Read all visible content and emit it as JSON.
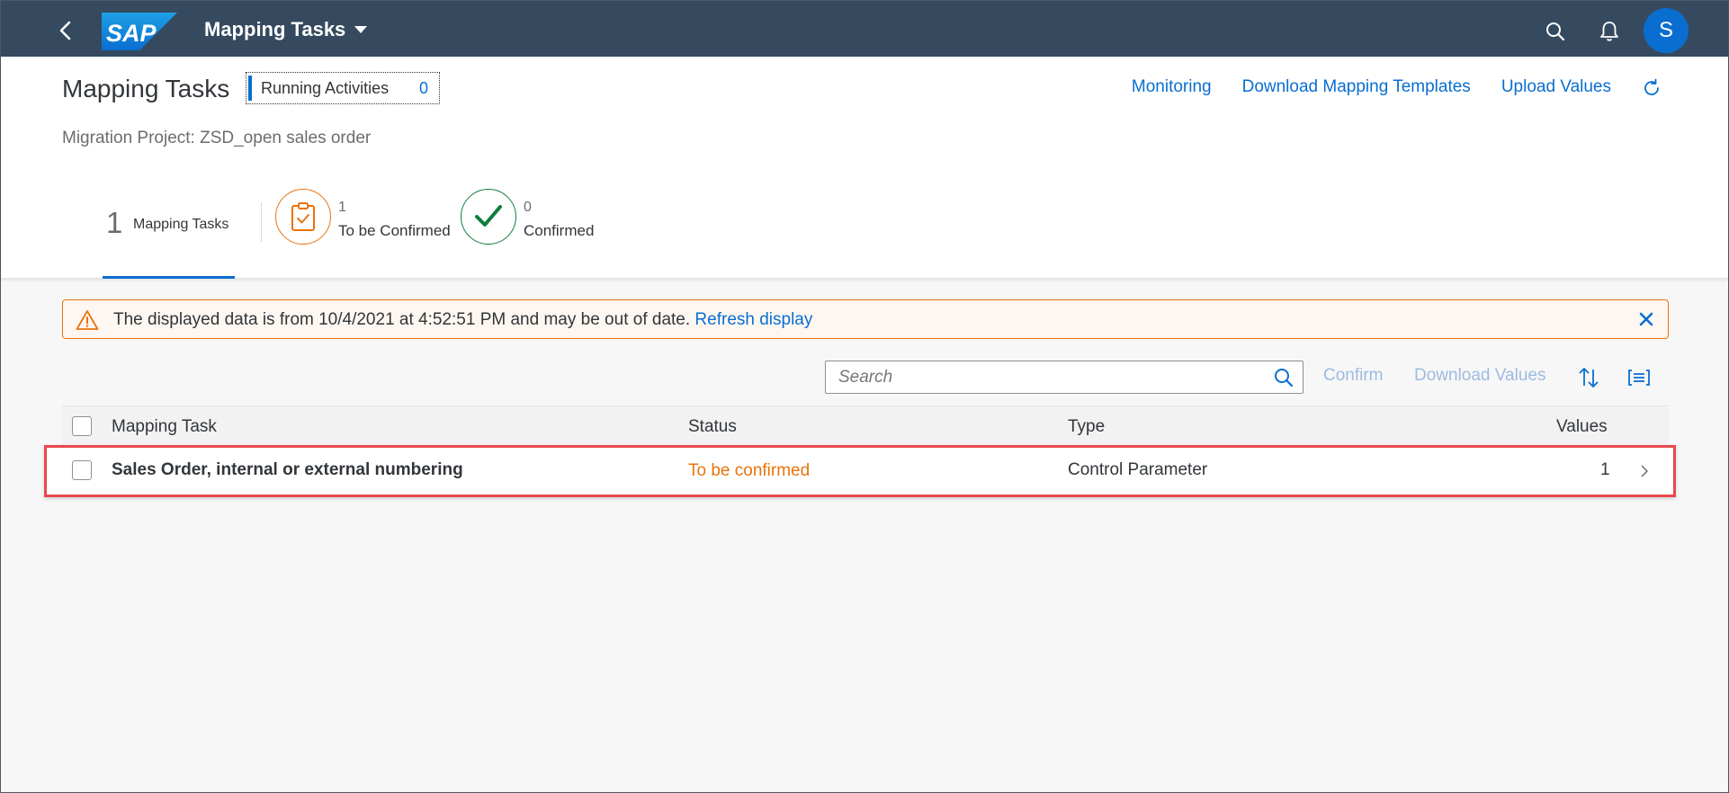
{
  "shell": {
    "title": "Mapping Tasks",
    "logo_text": "SAP",
    "avatar_initial": "S"
  },
  "header": {
    "title": "Mapping Tasks",
    "running_activities": {
      "label": "Running Activities",
      "count": "0"
    },
    "links": {
      "monitoring": "Monitoring",
      "download_templates": "Download Mapping Templates",
      "upload_values": "Upload Values"
    },
    "project": "Migration Project: ZSD_open sales order"
  },
  "tabs": {
    "all": {
      "count": "1",
      "label": "Mapping Tasks"
    },
    "to_be_confirmed": {
      "count": "1",
      "label": "To be Confirmed"
    },
    "confirmed": {
      "count": "0",
      "label": "Confirmed"
    }
  },
  "message": {
    "text": "The displayed data is from 10/4/2021 at 4:52:51 PM and may be out of date.",
    "link": "Refresh display"
  },
  "toolbar": {
    "search_placeholder": "Search",
    "confirm_label": "Confirm",
    "download_values_label": "Download Values"
  },
  "table": {
    "columns": {
      "task": "Mapping Task",
      "status": "Status",
      "type": "Type",
      "values": "Values"
    },
    "rows": [
      {
        "task": "Sales Order, internal or external numbering",
        "status": "To be confirmed",
        "type": "Control Parameter",
        "values": "1"
      }
    ]
  },
  "colors": {
    "shell_bg": "#354a5f",
    "accent": "#0a6ed1",
    "warning": "#e9730c",
    "success": "#107e3e",
    "highlight": "#e8484e"
  }
}
